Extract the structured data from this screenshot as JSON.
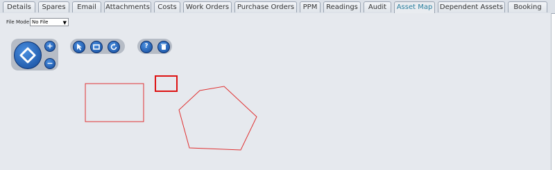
{
  "tabs": [
    {
      "label": "Details",
      "active": false
    },
    {
      "label": "Spares",
      "active": false
    },
    {
      "label": "Email",
      "active": false
    },
    {
      "label": "Attachments",
      "active": false
    },
    {
      "label": "Costs",
      "active": false
    },
    {
      "label": "Work Orders",
      "active": false
    },
    {
      "label": "Purchase Orders",
      "active": false
    },
    {
      "label": "PPM",
      "active": false
    },
    {
      "label": "Readings",
      "active": false
    },
    {
      "label": "Audit",
      "active": false
    },
    {
      "label": "Asset Map",
      "active": true
    },
    {
      "label": "Dependent Assets",
      "active": false
    },
    {
      "label": "Booking",
      "active": false
    }
  ],
  "file_mode": {
    "label": "File Mode",
    "value": "No File"
  },
  "navigation": {
    "pan_icon": "pan-arrows-icon",
    "zoom_in_icon": "plus-icon",
    "zoom_out_icon": "minus-icon"
  },
  "tools": {
    "select_icon": "cursor-icon",
    "rectangle_icon": "rectangle-icon",
    "rotate_icon": "rotate-icon",
    "help_icon": "help-icon",
    "delete_icon": "trash-icon"
  },
  "colors": {
    "accent": "#2a7f9e",
    "shape_stroke": "#e03030",
    "selected_stroke": "#dd1111",
    "button": "#1f5fb8"
  }
}
